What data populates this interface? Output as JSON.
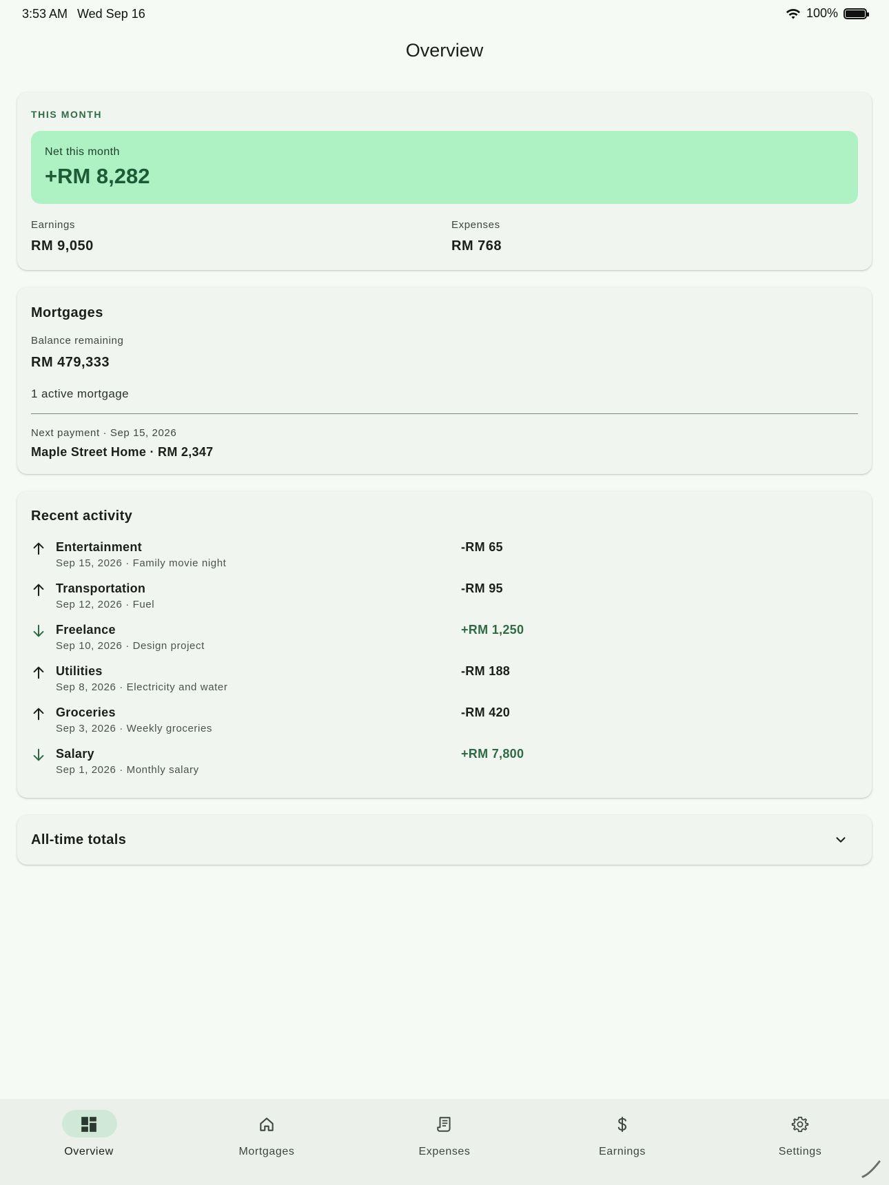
{
  "status": {
    "time": "3:53 AM",
    "date": "Wed Sep 16",
    "battery": "100%"
  },
  "page_title": "Overview",
  "this_month": {
    "caption": "THIS MONTH",
    "net_label": "Net this month",
    "net_value": "+RM 8,282",
    "earnings_label": "Earnings",
    "earnings_value": "RM 9,050",
    "expenses_label": "Expenses",
    "expenses_value": "RM 768"
  },
  "mortgages": {
    "title": "Mortgages",
    "balance_label": "Balance remaining",
    "balance_value": "RM 479,333",
    "active_count": "1 active mortgage",
    "next_label": "Next payment · Sep 15, 2026",
    "next_value": "Maple Street Home · RM 2,347"
  },
  "recent": {
    "title": "Recent activity",
    "items": [
      {
        "title": "Entertainment",
        "sub": "Sep 15, 2026 · Family movie night",
        "amount": "-RM 65",
        "direction": "up"
      },
      {
        "title": "Transportation",
        "sub": "Sep 12, 2026 · Fuel",
        "amount": "-RM 95",
        "direction": "up"
      },
      {
        "title": "Freelance",
        "sub": "Sep 10, 2026 · Design project",
        "amount": "+RM 1,250",
        "direction": "down"
      },
      {
        "title": "Utilities",
        "sub": "Sep 8, 2026 · Electricity and water",
        "amount": "-RM 188",
        "direction": "up"
      },
      {
        "title": "Groceries",
        "sub": "Sep 3, 2026 · Weekly groceries",
        "amount": "-RM 420",
        "direction": "up"
      },
      {
        "title": "Salary",
        "sub": "Sep 1, 2026 · Monthly salary",
        "amount": "+RM 7,800",
        "direction": "down"
      }
    ]
  },
  "totals": {
    "title": "All-time totals"
  },
  "nav": {
    "items": [
      {
        "label": "Overview",
        "icon": "dashboard-icon",
        "active": true
      },
      {
        "label": "Mortgages",
        "icon": "home-icon",
        "active": false
      },
      {
        "label": "Expenses",
        "icon": "receipt-icon",
        "active": false
      },
      {
        "label": "Earnings",
        "icon": "dollar-icon",
        "active": false
      },
      {
        "label": "Settings",
        "icon": "gear-icon",
        "active": false
      }
    ]
  },
  "colors": {
    "background": "#f6faf4",
    "card": "#f1f5ef",
    "accent": "#2f6a47",
    "net_box": "#aef2c4",
    "income": "#2f6a47",
    "expense": "#1b1f1c",
    "nav_active": "#cfe9d6"
  }
}
